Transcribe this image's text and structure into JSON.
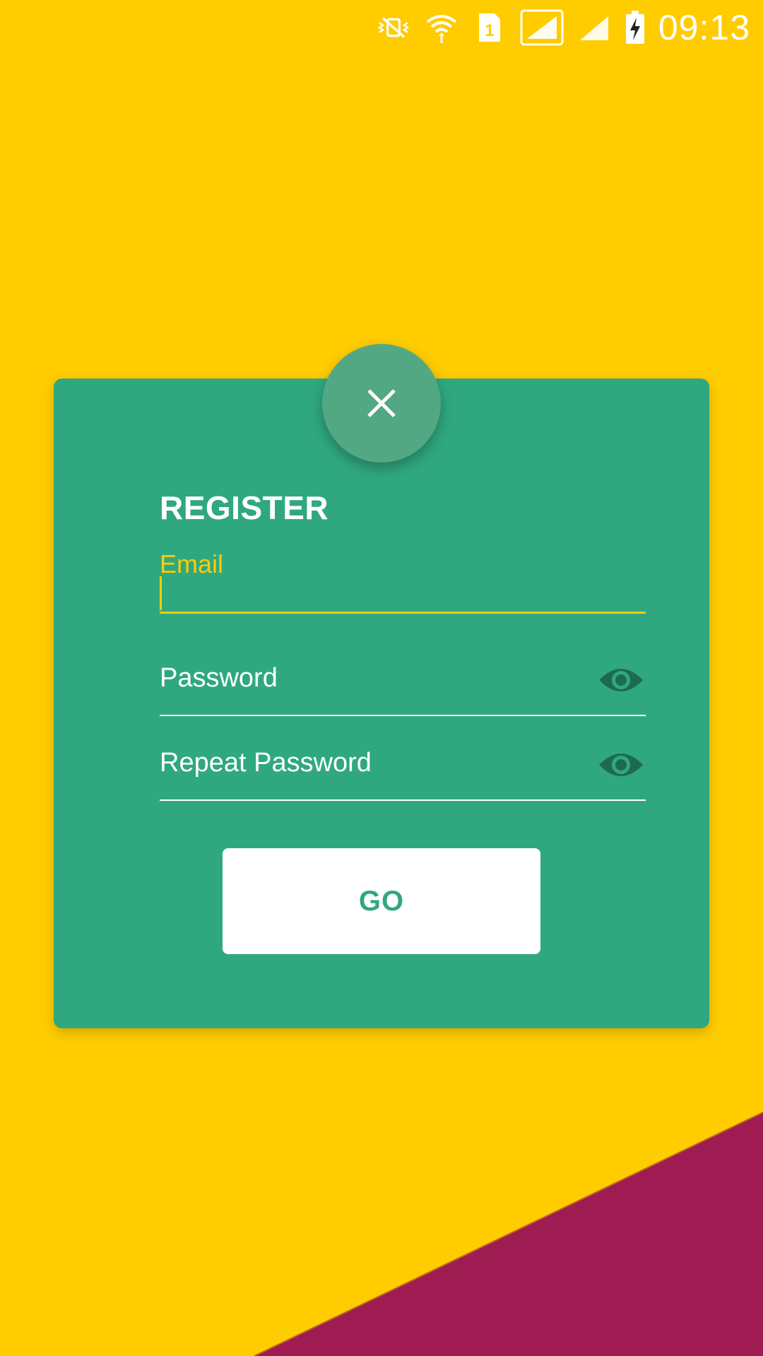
{
  "status_bar": {
    "time": "09:13",
    "icons": [
      "vibrate-mute-icon",
      "wifi-icon",
      "sim-1-icon",
      "signal-icon",
      "signal-2-icon",
      "battery-charging-icon"
    ]
  },
  "colors": {
    "background": "#ffcc00",
    "accent_stripe": "#9e1c52",
    "card": "#2fa880",
    "fab": "#52a883",
    "eye_icon": "#1e6a50",
    "button_text": "#2fa880"
  },
  "close_button": {
    "icon": "close-icon"
  },
  "form": {
    "title": "REGISTER",
    "email": {
      "label": "Email",
      "value": ""
    },
    "password": {
      "placeholder": "Password",
      "value": "",
      "toggle_icon": "eye-icon"
    },
    "repeat_password": {
      "placeholder": "Repeat Password",
      "value": "",
      "toggle_icon": "eye-icon"
    },
    "submit_label": "GO"
  }
}
